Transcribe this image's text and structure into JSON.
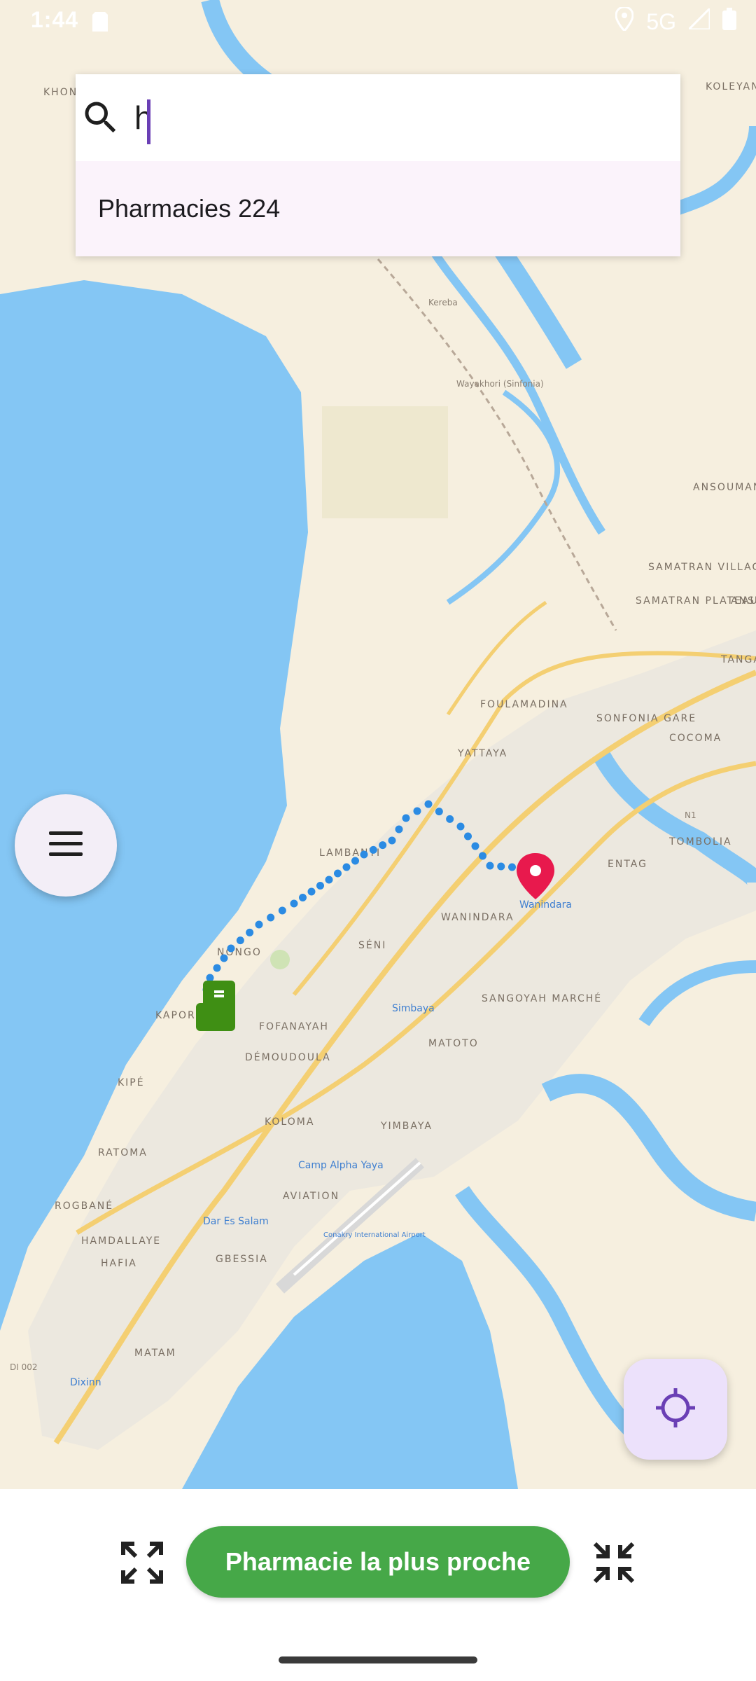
{
  "status_bar": {
    "time": "1:44",
    "network": "5G",
    "icons": [
      "sd-card-icon",
      "location-icon",
      "signal-icon",
      "battery-icon"
    ]
  },
  "search": {
    "value": "h",
    "suggestions": [
      "Pharmacies 224"
    ]
  },
  "map": {
    "area_labels": [
      "KOLEYAN",
      "KHONI",
      "Kereba",
      "Wayakhori (Sinfonia)",
      "ANSOUMANI VILLAGE",
      "SAMATRAN VILLAGE",
      "SAMATRAN PLATEAU",
      "ANSOU PLA",
      "TANGA",
      "FOULAMADINA",
      "SONFONIA GARE",
      "COCOMA",
      "YATTAYA",
      "N1",
      "TOMBOLIA",
      "LAMBANYI",
      "ENTAG",
      "WANINDARA",
      "SÉNI",
      "NONGO",
      "KAPORO",
      "SANGOYAH MARCHÉ",
      "FOFANAYAH",
      "MATOTO",
      "DÉMOUDOULA",
      "KIPÉ",
      "KOLOMA",
      "YIMBAYA",
      "RATOMA",
      "AVIATION",
      "ROGBANÉ",
      "HAMDALLAYE",
      "HAFIA",
      "GBESSIA",
      "MATAM",
      "DI 002"
    ],
    "poi_labels": [
      "Wanindara",
      "Simbaya",
      "Camp Alpha Yaya",
      "Dar Es Salam",
      "Conakry International Airport",
      "Dixinn"
    ],
    "colors": {
      "water": "#84c6f4",
      "land": "#f6efdf",
      "urban": "#ece8df",
      "road": "#f4cf72",
      "route": "#2b8be3",
      "destination_pin": "#e8194d",
      "pharmacy_marker": "#3f8f14"
    }
  },
  "buttons": {
    "menu": "menu-icon",
    "locate": "my-location-icon",
    "expand": "fullscreen-icon",
    "collapse": "fullscreen-exit-icon",
    "nearest_pharmacy": "Pharmacie la plus proche"
  }
}
